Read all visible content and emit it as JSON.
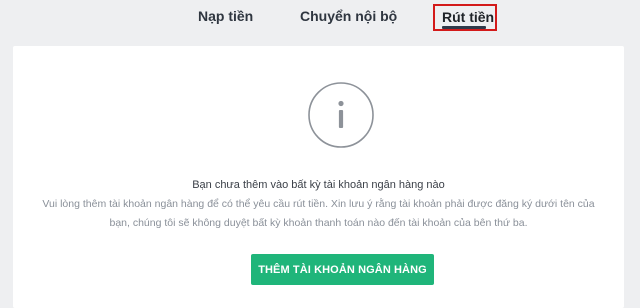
{
  "tabs": [
    {
      "label": "Nạp tiền"
    },
    {
      "label": "Chuyển nội bộ"
    },
    {
      "label": "Rút tiền",
      "active": true
    }
  ],
  "colors": {
    "background": "#eeeff1",
    "card": "#ffffff",
    "accent": "#1fb57a",
    "highlight_box": "#d31a1a"
  },
  "empty_state": {
    "icon": "info-icon",
    "heading": "Bạn chưa thêm vào bất kỳ tài khoản ngân hàng nào",
    "description_line1": "Vui lòng thêm tài khoản ngân hàng để có thể yêu cầu rút tiền. Xin lưu ý rằng tài khoản phải được đăng ký dưới tên của",
    "description_line2": "bạn, chúng tôi sẽ không duyệt bất kỳ khoản thanh toán nào đến tài khoản của bên thứ ba.",
    "button_label": "THÊM TÀI KHOẢN NGÂN HÀNG"
  }
}
